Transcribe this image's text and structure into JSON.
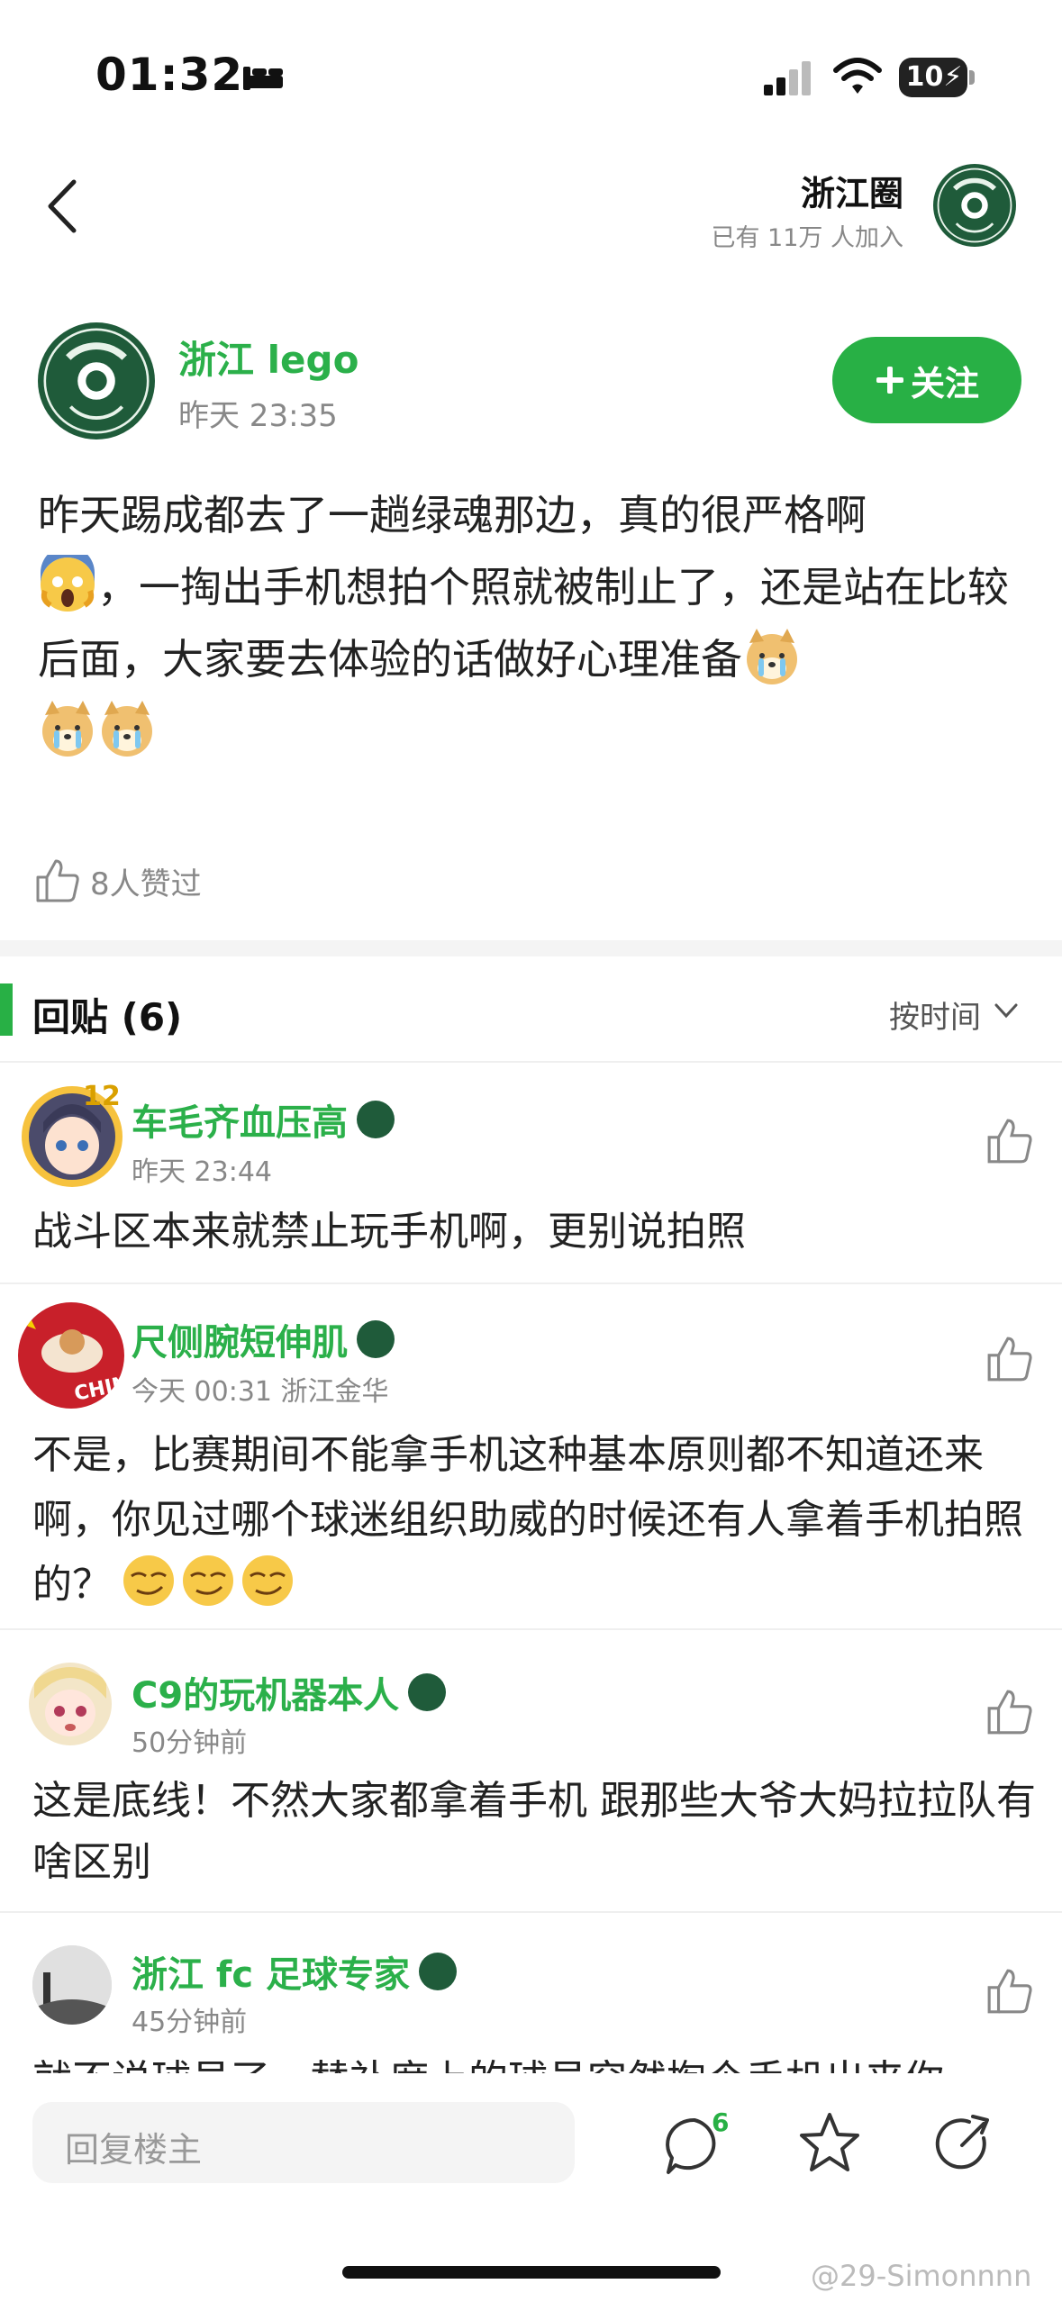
{
  "status_bar": {
    "time": "01:32",
    "battery": "10"
  },
  "header": {
    "circle_name": "浙江圈",
    "member_count": "已有 11万 人加入"
  },
  "post": {
    "author": "浙江 lego",
    "time": "昨天 23:35",
    "follow_label": "关注",
    "body_part1": "昨天踢成都去了一趟绿魂那边，真的很严格啊",
    "body_part2": "，一掏出手机想拍个照就被制止了，还是站在比较后面，大家要去体验的话做好心理准备",
    "likes": "8人赞过"
  },
  "replies": {
    "title": "回贴 (6)",
    "sort_label": "按时间",
    "items": [
      {
        "name": "车毛齐血压高",
        "meta": "昨天 23:44",
        "text": "战斗区本来就禁止玩手机啊，更别说拍照",
        "level": "12"
      },
      {
        "name": "尺侧腕短伸肌",
        "meta": "今天 00:31 浙江金华",
        "text": "不是，比赛期间不能拿手机这种基本原则都不知道还来啊，你见过哪个球迷组织助威的时候还有人拿着手机拍照的？",
        "avatar_tag": "CHINA"
      },
      {
        "name": "C9的玩机器本人",
        "meta": "50分钟前",
        "text": "这是底线！不然大家都拿着手机 跟那些大爷大妈拉拉队有啥区别"
      },
      {
        "name": "浙江 fc 足球专家",
        "meta": "45分钟前",
        "text": "就不说球员了，替补席上的球员突然掏个手机出来你"
      }
    ]
  },
  "bottom_bar": {
    "reply_placeholder": "回复楼主",
    "comment_count": "6"
  },
  "watermark": "@29-Simonnnn",
  "colors": {
    "accent": "#28b045",
    "name_green": "#2bb04a",
    "logo_green": "#1f5b3a"
  }
}
